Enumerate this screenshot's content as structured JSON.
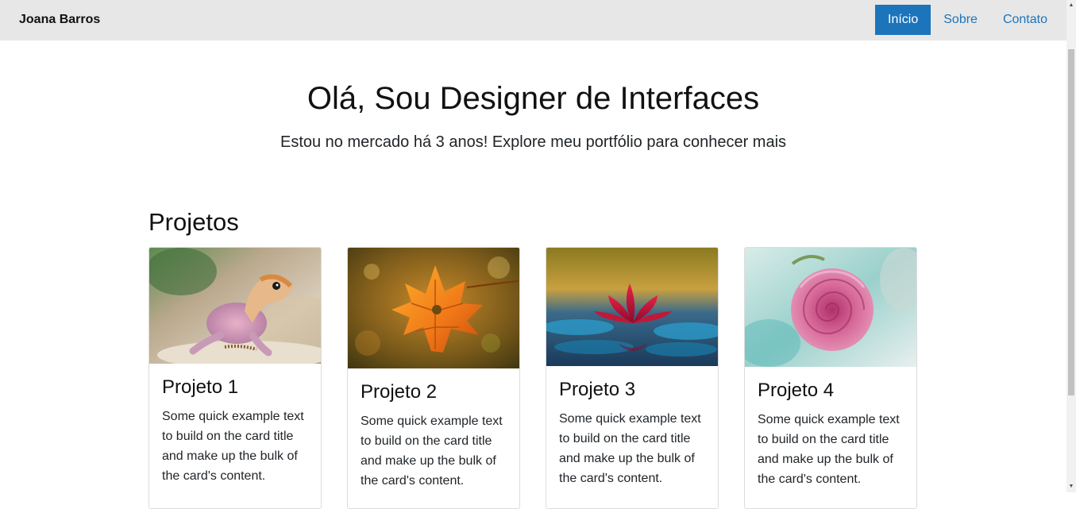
{
  "navbar": {
    "brand": "Joana Barros",
    "links": [
      {
        "label": "Início",
        "active": true
      },
      {
        "label": "Sobre",
        "active": false
      },
      {
        "label": "Contato",
        "active": false
      }
    ]
  },
  "hero": {
    "title": "Olá, Sou Designer de Interfaces",
    "subtitle": "Estou no mercado há 3 anos! Explore meu portfólio para conhecer mais"
  },
  "projects": {
    "heading": "Projetos",
    "cards": [
      {
        "title": "Projeto 1",
        "text": "Some quick example text to build on the card title and make up the bulk of the card's content.",
        "image": "gecko-lizard"
      },
      {
        "title": "Projeto 2",
        "text": "Some quick example text to build on the card title and make up the bulk of the card's content.",
        "image": "autumn-maple-leaf"
      },
      {
        "title": "Projeto 3",
        "text": "Some quick example text to build on the card title and make up the bulk of the card's content.",
        "image": "red-water-lily"
      },
      {
        "title": "Projeto 4",
        "text": "Some quick example text to build on the card title and make up the bulk of the card's content.",
        "image": "pink-rose"
      }
    ]
  },
  "colors": {
    "navbar_bg": "#e7e7e7",
    "accent": "#1c74bb",
    "text": "#212529"
  }
}
